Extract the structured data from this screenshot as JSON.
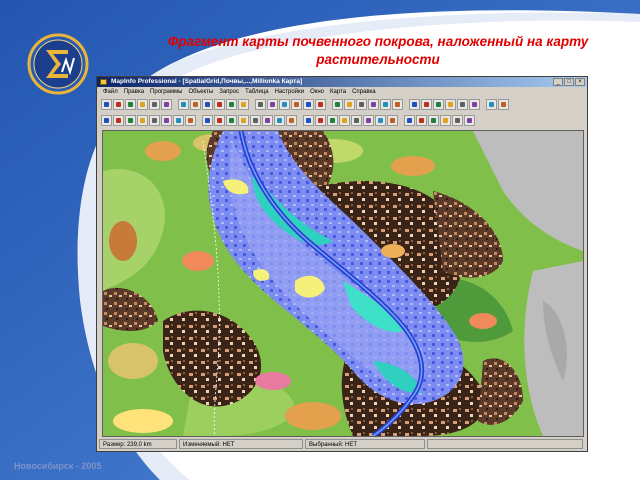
{
  "slide": {
    "title": "Фрагмент карты почвенного покрова, наложенный на карту растительности",
    "footer": "Новосибирск - 2005"
  },
  "window": {
    "title": "MapInfo Professional - [SpatialGrid,Почвы,...,Millionka Карта]",
    "controls": [
      "_",
      "□",
      "×"
    ]
  },
  "menu": [
    "Файл",
    "Правка",
    "Программы",
    "Объекты",
    "Запрос",
    "Таблица",
    "Настройки",
    "Окно",
    "Карта",
    "Справка"
  ],
  "status": {
    "size": "Размер: 239,0 km",
    "edited": "Изменяемый: НЕТ",
    "selected": "Выбранный: НЕТ"
  },
  "colors": {
    "title_red": "#e00000",
    "bg_blue": "#1f4fa3",
    "logo_gold": "#e9b53a",
    "map_green": "#7fbf4a",
    "river_blue": "#2d3fd0",
    "water_cyan": "#30d0c0",
    "soil_brown": "#3a2418",
    "gray_zone": "#bdbdbd"
  },
  "icons": [
    "logo-sigma-icon",
    "mapinfo-app-icon"
  ]
}
